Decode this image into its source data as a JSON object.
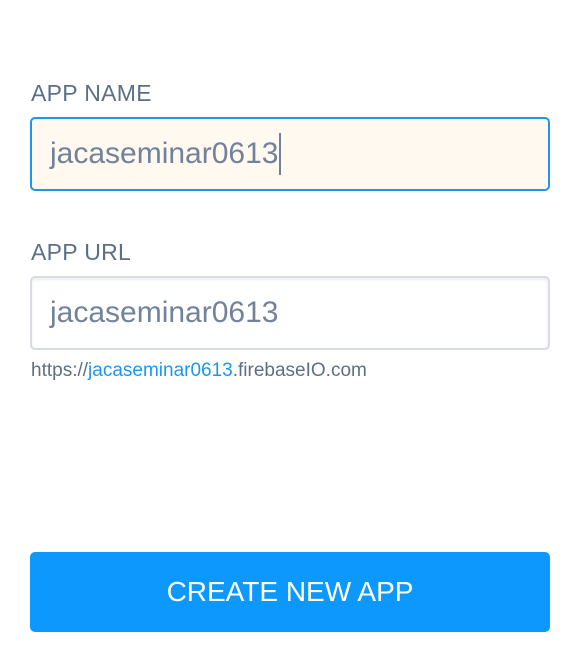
{
  "form": {
    "app_name_label": "APP NAME",
    "app_name_value": "jacaseminar0613",
    "app_url_label": "APP URL",
    "app_url_value": "jacaseminar0613",
    "url_hint": {
      "prefix": "https://",
      "subdomain": "jacaseminar0613",
      "suffix": ".firebaseIO.com"
    },
    "submit_label": "CREATE NEW APP"
  },
  "colors": {
    "accent": "#0c98fc",
    "focus_border": "#1e96f0",
    "label": "#5d6f88"
  }
}
